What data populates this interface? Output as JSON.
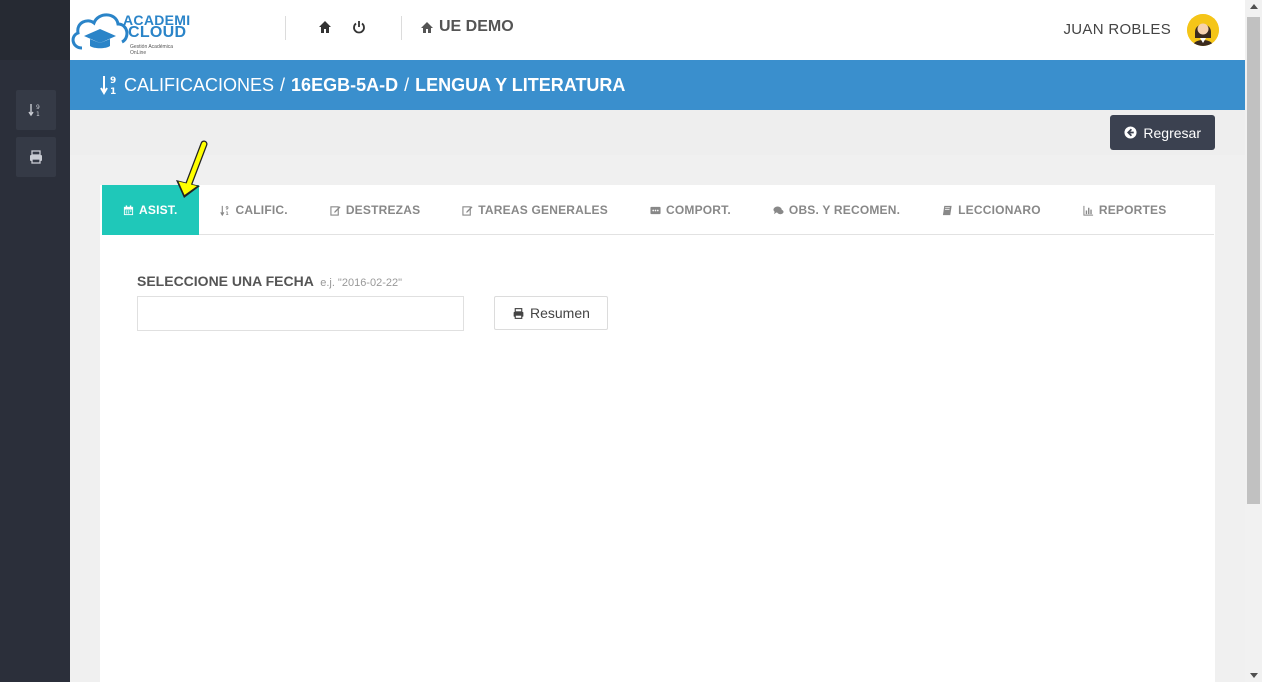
{
  "app": {
    "logo_line1": "ACADEMI",
    "logo_line2": "CLOUD",
    "logo_tagline": "Gestión Académica OnLine",
    "school": "UE DEMO",
    "user": "JUAN ROBLES"
  },
  "title": {
    "section": "CALIFICACIONES",
    "separator": "/",
    "course": "16EGB-5A-D",
    "subject": "LENGUA Y LITERATURA"
  },
  "actions": {
    "back_label": "Regresar"
  },
  "tabs": [
    {
      "label": "ASIST.",
      "icon": "calendar-icon",
      "active": true
    },
    {
      "label": "CALIFIC.",
      "icon": "sort-numeric-icon",
      "active": false
    },
    {
      "label": "DESTREZAS",
      "icon": "edit-icon",
      "active": false
    },
    {
      "label": "TAREAS GENERALES",
      "icon": "edit-icon",
      "active": false
    },
    {
      "label": "COMPORT.",
      "icon": "comment-dots-icon",
      "active": false
    },
    {
      "label": "OBS. Y RECOMEN.",
      "icon": "comments-icon",
      "active": false
    },
    {
      "label": "LECCIONARO",
      "icon": "book-icon",
      "active": false
    },
    {
      "label": "REPORTES",
      "icon": "bar-chart-icon",
      "active": false
    }
  ],
  "form": {
    "date_label": "SELECCIONE UNA FECHA",
    "date_hint": "e.j. \"2016-02-22\"",
    "date_value": "",
    "summary_label": "Resumen"
  },
  "colors": {
    "sidebar": "#2b2f3a",
    "title_bar": "#3a8fcd",
    "active_tab": "#1fc8b9",
    "back_button": "#3b4150",
    "annotation_arrow": "#ffff00"
  }
}
